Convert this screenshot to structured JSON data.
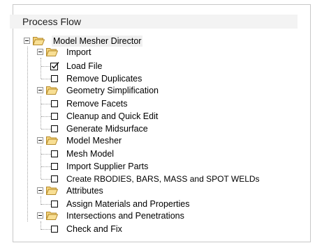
{
  "panel": {
    "title": "Process Flow"
  },
  "tree": {
    "root": {
      "label": "Model Mesher Director",
      "icon": "folder-open-icon",
      "expanded": true
    },
    "groups": [
      {
        "label": "Import",
        "icon": "folder-open-icon",
        "expanded": true,
        "items": [
          {
            "label": "Load File",
            "checked": true
          },
          {
            "label": "Remove Duplicates",
            "checked": false
          }
        ]
      },
      {
        "label": "Geometry Simplification",
        "icon": "folder-open-icon",
        "expanded": true,
        "items": [
          {
            "label": "Remove Facets",
            "checked": false
          },
          {
            "label": "Cleanup and Quick Edit",
            "checked": false
          },
          {
            "label": "Generate Midsurface",
            "checked": false
          }
        ]
      },
      {
        "label": "Model Mesher",
        "icon": "folder-open-icon",
        "expanded": true,
        "items": [
          {
            "label": "Mesh Model",
            "checked": false
          },
          {
            "label": "Import Supplier Parts",
            "checked": false
          },
          {
            "label": "Create RBODIES, BARS, MASS and SPOT WELDs",
            "checked": false
          }
        ]
      },
      {
        "label": "Attributes",
        "icon": "folder-open-icon",
        "expanded": true,
        "items": [
          {
            "label": "Assign Materials and Properties",
            "checked": false
          }
        ]
      },
      {
        "label": "Intersections and Penetrations",
        "icon": "folder-open-icon",
        "expanded": true,
        "items": [
          {
            "label": "Check and Fix",
            "checked": false
          }
        ]
      }
    ]
  },
  "colors": {
    "folder_fill": "#f4d27a",
    "folder_stroke": "#b58a2a",
    "check_mark": "#1a1a1a"
  }
}
